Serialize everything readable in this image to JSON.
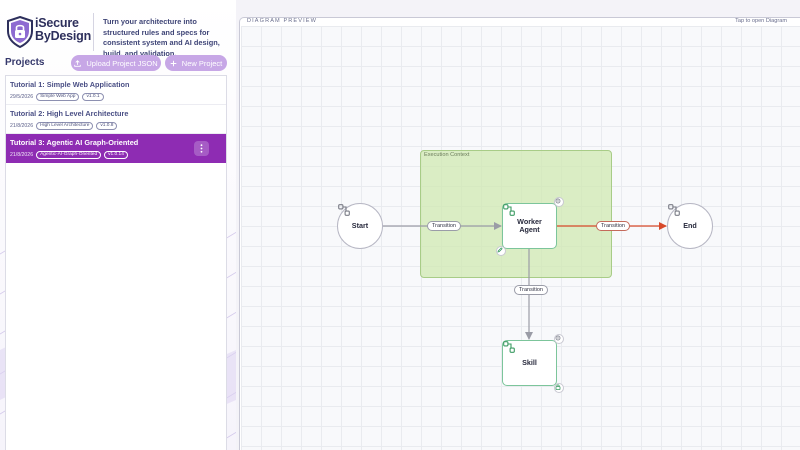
{
  "brand": {
    "name_line1": "iSecure",
    "name_line2": "ByDesign",
    "tagline": "Turn your architecture into structured rules and specs for consistent system and AI design, build, and validation."
  },
  "projects_panel": {
    "title": "Projects",
    "upload_label": "Upload Project JSON",
    "new_label": "New Project",
    "projects": [
      {
        "name": "Tutorial 1: Simple Web Application",
        "date": "29/5/2026",
        "tag": "Simple Web App",
        "version": "v1.0.1"
      },
      {
        "name": "Tutorial 2: High Level Architecture",
        "date": "21/8/2026",
        "tag": "High Level Architecture",
        "version": "v1.0.8"
      },
      {
        "name": "Tutorial 3: Agentic AI Graph-Oriented",
        "date": "21/8/2026",
        "tag": "Agentic-AI-Graph-Oriented",
        "version": "v1.0.14",
        "active": true
      }
    ]
  },
  "diagram": {
    "title": "DIAGRAM PREVIEW",
    "hint": "Tap to open Diagram",
    "context_label": "Execution Context",
    "nodes": {
      "start": "Start",
      "worker_line1": "Worker",
      "worker_line2": "Agent",
      "end": "End",
      "skill": "Skill"
    },
    "edges": {
      "start_to_worker": "Transition",
      "worker_to_end": "Transition",
      "worker_to_skill": "Transition"
    },
    "colors": {
      "edge": "#9a9ca6",
      "edge_active": "#d84a2b",
      "node_border": "#7cc59b",
      "context_fill": "#cfe8b0",
      "accent": "#8e2cb3"
    }
  }
}
